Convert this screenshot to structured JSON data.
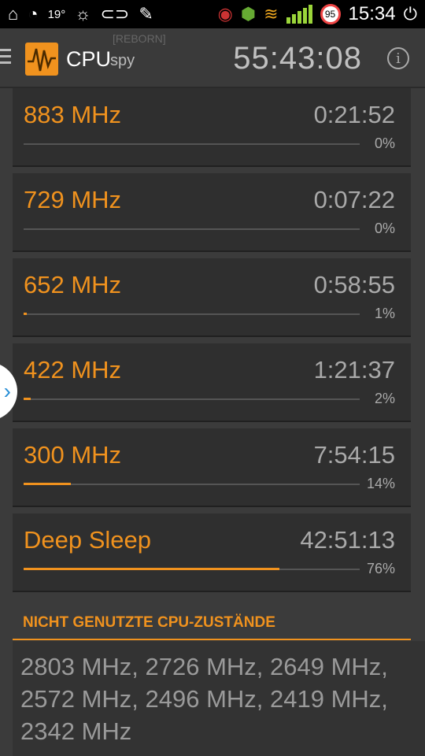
{
  "status_bar": {
    "temperature": "19°",
    "battery_badge": "95",
    "time": "15:34",
    "icons": [
      "home-icon",
      "timer-icon",
      "brightness-icon",
      "toggle-icon",
      "pencil-icon",
      "eye-icon",
      "android-icon",
      "wifi-icon",
      "signal-icon",
      "power-icon"
    ]
  },
  "app_bar": {
    "app_name": "CPU",
    "app_sub": "spy",
    "reborn": "[REBORN]",
    "uptime": "55:43:08",
    "info_icon": "i"
  },
  "states": [
    {
      "freq": "883 MHz",
      "duration": "0:21:52",
      "percent_label": "0%",
      "percent": 0
    },
    {
      "freq": "729 MHz",
      "duration": "0:07:22",
      "percent_label": "0%",
      "percent": 0
    },
    {
      "freq": "652 MHz",
      "duration": "0:58:55",
      "percent_label": "1%",
      "percent": 1
    },
    {
      "freq": "422 MHz",
      "duration": "1:21:37",
      "percent_label": "2%",
      "percent": 2
    },
    {
      "freq": "300 MHz",
      "duration": "7:54:15",
      "percent_label": "14%",
      "percent": 14
    },
    {
      "freq": "Deep Sleep",
      "duration": "42:51:13",
      "percent_label": "76%",
      "percent": 76
    }
  ],
  "side_tab": "›",
  "unused": {
    "title": "NICHT GENUTZTE CPU-ZUSTÄNDE",
    "text": "2803 MHz, 2726 MHz, 2649 MHz, 2572 MHz, 2496 MHz, 2419 MHz, 2342 MHz"
  },
  "colors": {
    "accent": "#f0921e",
    "background": "#3b3b3b",
    "card": "#2f2f2f"
  }
}
